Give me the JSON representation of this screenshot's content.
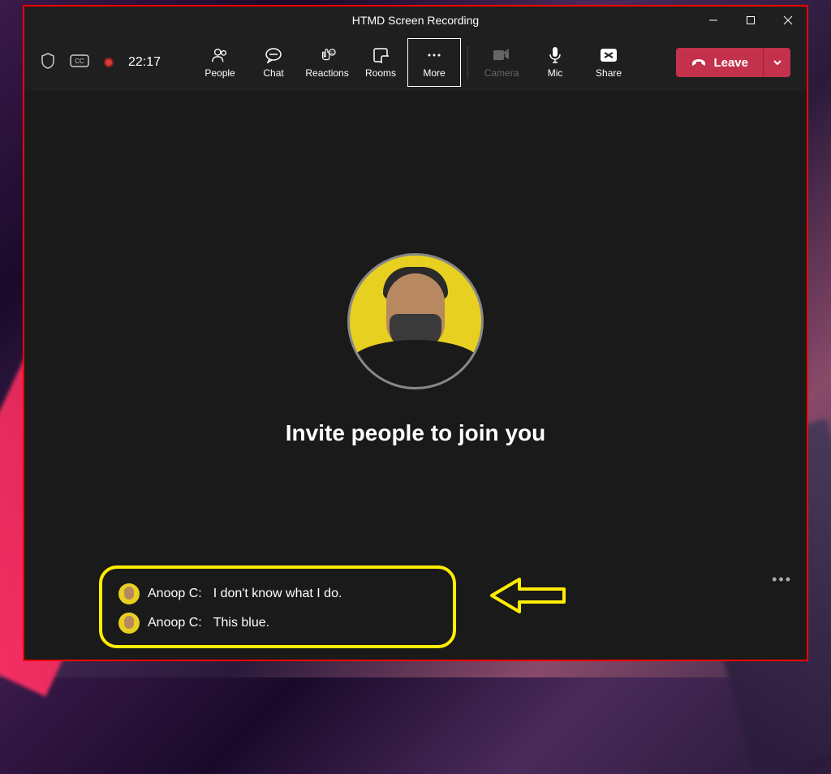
{
  "window": {
    "title": "HTMD Screen Recording"
  },
  "meeting": {
    "timer": "22:17"
  },
  "toolbar": {
    "people": "People",
    "chat": "Chat",
    "reactions": "Reactions",
    "rooms": "Rooms",
    "more": "More",
    "camera": "Camera",
    "mic": "Mic",
    "share": "Share",
    "leave": "Leave"
  },
  "main": {
    "invite_text": "Invite people to join you"
  },
  "captions": [
    {
      "name": "Anoop C:",
      "text": "I don't know what I do."
    },
    {
      "name": "Anoop C:",
      "text": "This blue."
    }
  ]
}
